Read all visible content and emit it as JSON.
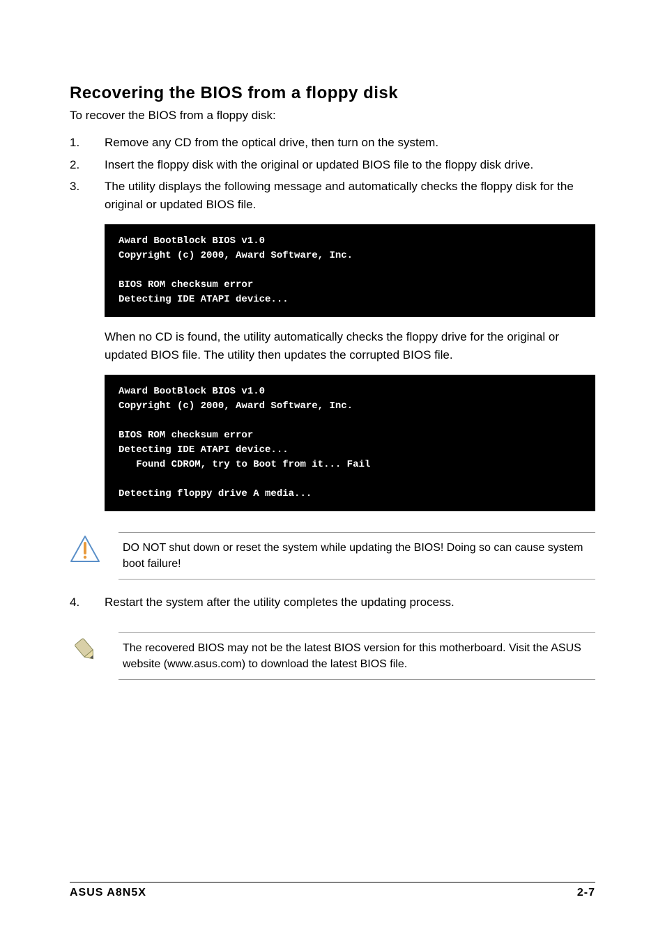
{
  "section_title": "Recovering the BIOS from a floppy disk",
  "intro_text": "To recover the BIOS from a floppy disk:",
  "steps": [
    {
      "num": "1.",
      "text": "Remove any CD from the optical drive, then turn on the system."
    },
    {
      "num": "2.",
      "text": "Insert the floppy disk with the original or updated BIOS file to the floppy disk drive."
    },
    {
      "num": "3.",
      "text": "The utility displays the following message and automatically checks the floppy disk for the original or updated BIOS file."
    }
  ],
  "terminal1": "Award BootBlock BIOS v1.0\nCopyright (c) 2000, Award Software, Inc.\n\nBIOS ROM checksum error\nDetecting IDE ATAPI device...",
  "followup1": "When no CD is found, the utility automatically checks the floppy drive for the original or updated BIOS file. The utility then updates the corrupted BIOS file.",
  "terminal2": "Award BootBlock BIOS v1.0\nCopyright (c) 2000, Award Software, Inc.\n\nBIOS ROM checksum error\nDetecting IDE ATAPI device...\n   Found CDROM, try to Boot from it... Fail\n\nDetecting floppy drive A media...",
  "warning_note": "DO NOT shut down or reset the system while updating the BIOS! Doing so can cause system boot failure!",
  "step4": {
    "num": "4.",
    "text": "Restart the system after the utility completes the updating process."
  },
  "info_note": "The recovered BIOS may not be the latest BIOS version for this motherboard. Visit the ASUS website (www.asus.com) to download the latest BIOS file.",
  "footer_left": "ASUS A8N5X",
  "footer_right": "2-7"
}
